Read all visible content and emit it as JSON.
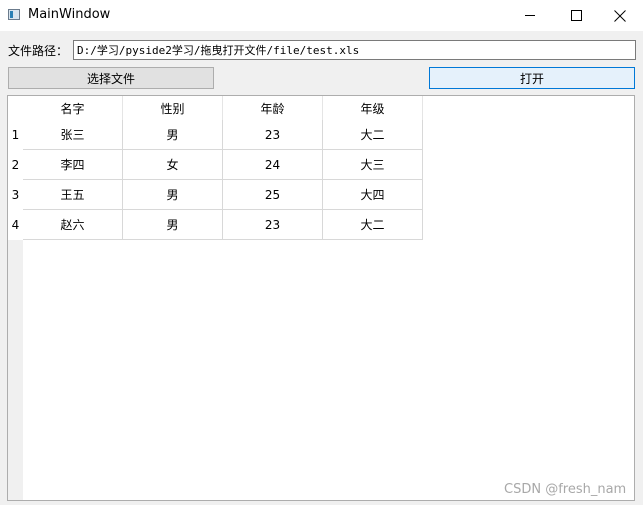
{
  "window": {
    "title": "MainWindow",
    "icon": "window-app-icon"
  },
  "controls": {
    "path_label": "文件路径：",
    "path_value": "D:/学习/pyside2学习/拖曳打开文件/file/test.xls",
    "choose_label": "选择文件",
    "open_label": "打开"
  },
  "table": {
    "columns": [
      "名字",
      "性别",
      "年龄",
      "年级"
    ],
    "row_numbers": [
      "1",
      "2",
      "3",
      "4"
    ],
    "rows": [
      [
        "张三",
        "男",
        "23",
        "大二"
      ],
      [
        "李四",
        "女",
        "24",
        "大三"
      ],
      [
        "王五",
        "男",
        "25",
        "大四"
      ],
      [
        "赵六",
        "男",
        "23",
        "大二"
      ]
    ]
  },
  "watermark": "CSDN @fresh_nam",
  "colors": {
    "open_button_border": "#0078d7",
    "open_button_bg": "#e5f1fb"
  }
}
